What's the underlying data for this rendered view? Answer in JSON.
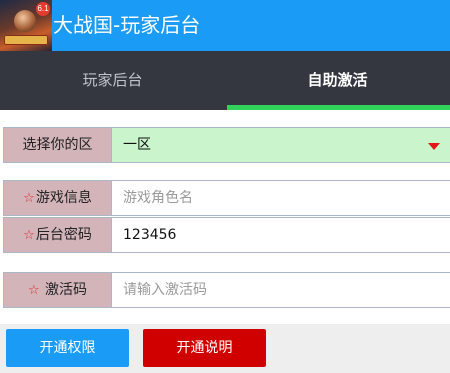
{
  "header": {
    "title": "大战国-玩家后台",
    "logo_badge": "6.1"
  },
  "tabs": [
    {
      "label": "玩家后台"
    },
    {
      "label": "自助激活"
    }
  ],
  "form": {
    "zone": {
      "label": "选择你的区",
      "value": "一区"
    },
    "role": {
      "label": "游戏信息",
      "placeholder": "游戏角色名",
      "value": ""
    },
    "password": {
      "label": "后台密码",
      "value": "123456"
    },
    "code": {
      "label": "激活码",
      "placeholder": "请输入激活码",
      "value": ""
    },
    "required_mark": "☆"
  },
  "buttons": {
    "open_rights": "开通权限",
    "open_help": "开通说明"
  },
  "colors": {
    "header_bg": "#1a9bf5",
    "tab_bg": "#343740",
    "tab_active_underline": "#2fd35a",
    "select_bg": "#c9f4cc",
    "label_bg": "#d2b4b9",
    "button_blue": "#1a9bf5",
    "button_red": "#d10000"
  }
}
